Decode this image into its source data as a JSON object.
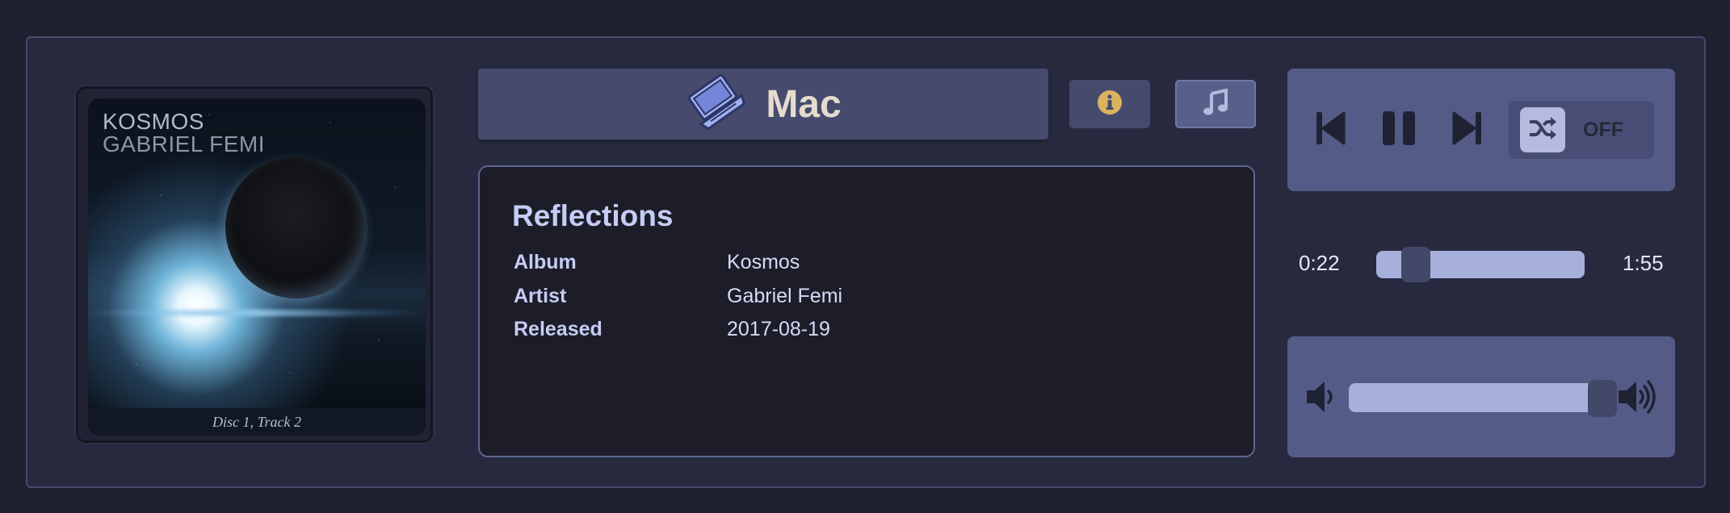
{
  "player": {
    "album_art": {
      "title_text": "KOSMOS",
      "artist_text": "GABRIEL FEMI",
      "caption": "Disc 1, Track 2"
    },
    "device": {
      "label": "Mac",
      "icon": "laptop-icon"
    },
    "buttons": {
      "info_icon": "info-icon",
      "music_icon": "music-note-icon"
    },
    "track": {
      "title": "Reflections",
      "meta": [
        {
          "key": "Album",
          "value": "Kosmos"
        },
        {
          "key": "Artist",
          "value": "Gabriel Femi"
        },
        {
          "key": "Released",
          "value": "2017-08-19"
        }
      ]
    },
    "controls": {
      "previous_icon": "skip-previous-icon",
      "pause_icon": "pause-icon",
      "next_icon": "skip-next-icon",
      "shuffle_icon": "shuffle-icon",
      "shuffle_state": "OFF"
    },
    "progress": {
      "elapsed": "0:22",
      "duration": "1:55",
      "fraction": 0.19
    },
    "volume": {
      "fraction": 0.98,
      "low_icon": "volume-low-icon",
      "high_icon": "volume-high-icon"
    },
    "colors": {
      "background": "#1f2030",
      "panel": "#272a3f",
      "accent": "#545b86",
      "slider": "#a7b0da",
      "info_icon": "#d9b45c",
      "device_label": "#e6dccd"
    }
  }
}
